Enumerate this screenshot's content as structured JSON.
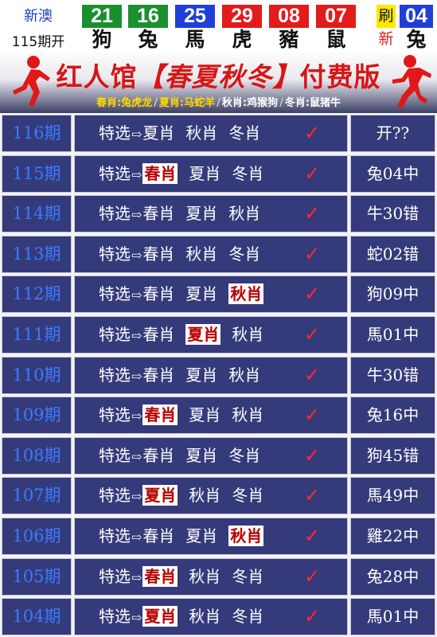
{
  "top": {
    "region": "新澳",
    "issue": "115期开",
    "balls": [
      {
        "num": "21",
        "zodiac": "狗",
        "color": "#1b8f2e"
      },
      {
        "num": "16",
        "zodiac": "兔",
        "color": "#1b8f2e"
      },
      {
        "num": "25",
        "zodiac": "馬",
        "color": "#1f3fd6"
      },
      {
        "num": "29",
        "zodiac": "虎",
        "color": "#e31b1b"
      },
      {
        "num": "08",
        "zodiac": "豬",
        "color": "#e31b1b"
      },
      {
        "num": "07",
        "zodiac": "鼠",
        "color": "#e31b1b"
      }
    ],
    "refresh_top": "刷",
    "refresh_bottom": "新",
    "special": {
      "num": "04",
      "zodiac": "兔",
      "color": "#1f3fd6"
    }
  },
  "banner": {
    "title_a": "红人馆",
    "title_b": "【春夏秋冬】",
    "title_c": "付费版",
    "seasons": [
      "春肖:兔虎龙",
      "夏肖:马蛇羊",
      "秋肖:鸡猴狗",
      "冬肖:鼠猪牛"
    ]
  },
  "pick_prefix": "特选",
  "arrow": "⇨",
  "check": "✓",
  "rows": [
    {
      "period": "116期",
      "picks": [
        "夏肖",
        "秋肖",
        "冬肖"
      ],
      "hit": -1,
      "result": "开??"
    },
    {
      "period": "115期",
      "picks": [
        "春肖",
        "夏肖",
        "冬肖"
      ],
      "hit": 0,
      "result": "兔04中"
    },
    {
      "period": "114期",
      "picks": [
        "春肖",
        "夏肖",
        "秋肖"
      ],
      "hit": -1,
      "result": "牛30错"
    },
    {
      "period": "113期",
      "picks": [
        "春肖",
        "秋肖",
        "冬肖"
      ],
      "hit": -1,
      "result": "蛇02错"
    },
    {
      "period": "112期",
      "picks": [
        "春肖",
        "夏肖",
        "秋肖"
      ],
      "hit": 2,
      "result": "狗09中"
    },
    {
      "period": "111期",
      "picks": [
        "春肖",
        "夏肖",
        "秋肖"
      ],
      "hit": 1,
      "result": "馬01中"
    },
    {
      "period": "110期",
      "picks": [
        "春肖",
        "夏肖",
        "秋肖"
      ],
      "hit": -1,
      "result": "牛30错"
    },
    {
      "period": "109期",
      "picks": [
        "春肖",
        "夏肖",
        "秋肖"
      ],
      "hit": 0,
      "result": "兔16中"
    },
    {
      "period": "108期",
      "picks": [
        "春肖",
        "夏肖",
        "冬肖"
      ],
      "hit": -1,
      "result": "狗45错"
    },
    {
      "period": "107期",
      "picks": [
        "夏肖",
        "秋肖",
        "冬肖"
      ],
      "hit": 0,
      "result": "馬49中"
    },
    {
      "period": "106期",
      "picks": [
        "春肖",
        "夏肖",
        "秋肖"
      ],
      "hit": 2,
      "result": "雞22中"
    },
    {
      "period": "105期",
      "picks": [
        "春肖",
        "秋肖",
        "冬肖"
      ],
      "hit": 0,
      "result": "兔28中"
    },
    {
      "period": "104期",
      "picks": [
        "夏肖",
        "秋肖",
        "冬肖"
      ],
      "hit": 0,
      "result": "馬01中"
    }
  ]
}
